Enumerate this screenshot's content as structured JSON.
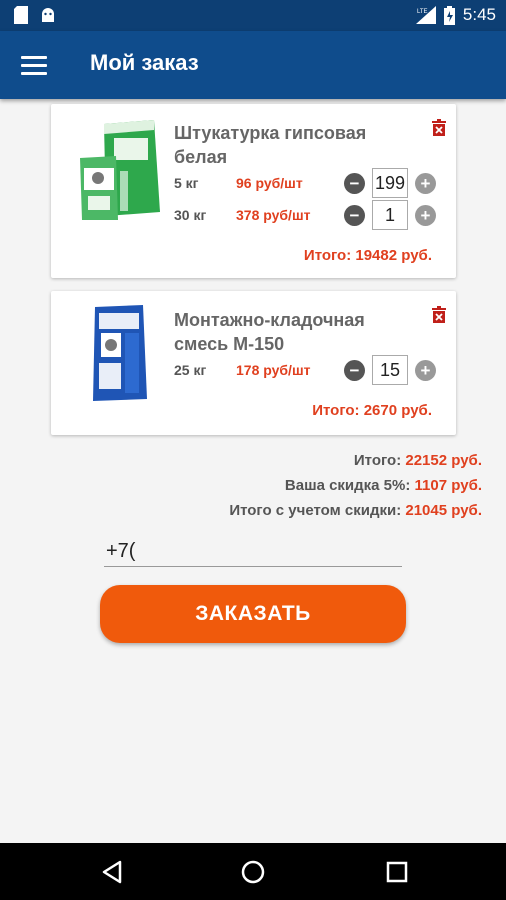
{
  "status_bar": {
    "time": "5:45",
    "network": "LTE",
    "icons": [
      "sd-card-icon",
      "android-icon",
      "signal-icon",
      "battery-icon"
    ]
  },
  "app_bar": {
    "title": "Мой заказ",
    "menu_icon": "hamburger-menu-icon"
  },
  "cart": {
    "items": [
      {
        "title": "Штукатурка гипсовая белая",
        "image": "plaster-bags-image",
        "variants": [
          {
            "size": "5 кг",
            "price": "96 руб/шт",
            "qty": "199"
          },
          {
            "size": "30 кг",
            "price": "378 руб/шт",
            "qty": "1"
          }
        ],
        "total": "Итого: 19482 руб."
      },
      {
        "title": "Монтажно-кладочная смесь М-150",
        "image": "masonry-mix-bag-image",
        "variants": [
          {
            "size": "25 кг",
            "price": "178 руб/шт",
            "qty": "15"
          }
        ],
        "total": "Итого: 2670 руб."
      }
    ]
  },
  "summary": {
    "total_label": "Итого:",
    "total_value": "22152 руб.",
    "discount_label": "Ваша скидка 5%:",
    "discount_value": "1107 руб.",
    "final_label": "Итого с учетом скидки:",
    "final_value": "21045 руб."
  },
  "phone_input": {
    "value": "+7("
  },
  "order_button": {
    "label": "ЗАКАЗАТЬ"
  },
  "colors": {
    "app_bar": "#0f4c8c",
    "status_bar": "#0d3f74",
    "accent_price": "#e0401f",
    "order_button": "#f05a0c"
  }
}
